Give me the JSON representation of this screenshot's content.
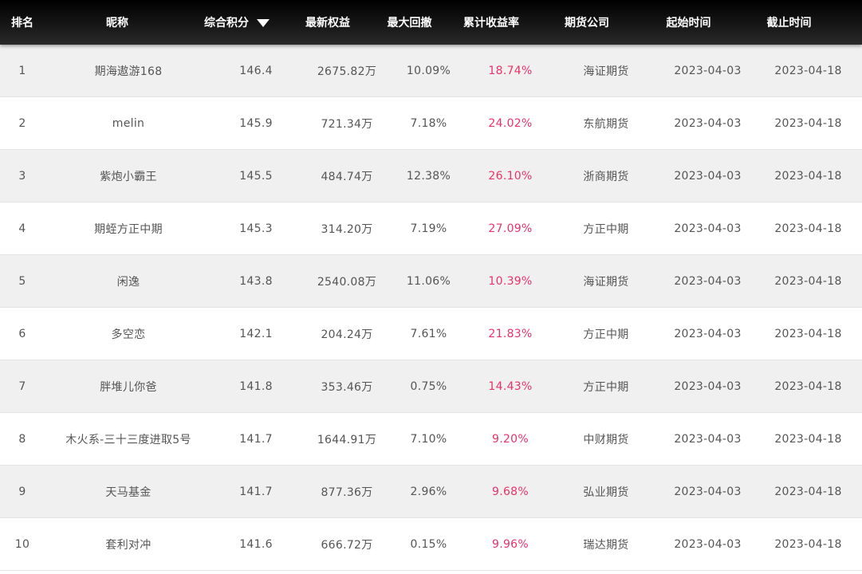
{
  "header": {
    "rank": "排名",
    "nickname": "昵称",
    "score": "综合积分",
    "equity": "最新权益",
    "drawdown": "最大回撤",
    "return": "累计收益率",
    "company": "期货公司",
    "start": "起始时间",
    "end": "截止时间",
    "sort_icon": "caret-down-icon"
  },
  "colors": {
    "header_bg": "#000000",
    "return_color": "#e8336a",
    "stripe": "#f0f0f0"
  },
  "rows": [
    {
      "rank": "1",
      "nickname": "期海遨游168",
      "score": "146.4",
      "equity": "2675.82万",
      "drawdown": "10.09%",
      "return": "18.74%",
      "company": "海证期货",
      "start": "2023-04-03",
      "end": "2023-04-18"
    },
    {
      "rank": "2",
      "nickname": "melin",
      "score": "145.9",
      "equity": "721.34万",
      "drawdown": "7.18%",
      "return": "24.02%",
      "company": "东航期货",
      "start": "2023-04-03",
      "end": "2023-04-18"
    },
    {
      "rank": "3",
      "nickname": "紫炮小霸王",
      "score": "145.5",
      "equity": "484.74万",
      "drawdown": "12.38%",
      "return": "26.10%",
      "company": "浙商期货",
      "start": "2023-04-03",
      "end": "2023-04-18"
    },
    {
      "rank": "4",
      "nickname": "期蛭方正中期",
      "score": "145.3",
      "equity": "314.20万",
      "drawdown": "7.19%",
      "return": "27.09%",
      "company": "方正中期",
      "start": "2023-04-03",
      "end": "2023-04-18"
    },
    {
      "rank": "5",
      "nickname": "闲逸",
      "score": "143.8",
      "equity": "2540.08万",
      "drawdown": "11.06%",
      "return": "10.39%",
      "company": "海证期货",
      "start": "2023-04-03",
      "end": "2023-04-18"
    },
    {
      "rank": "6",
      "nickname": "多空恋",
      "score": "142.1",
      "equity": "204.24万",
      "drawdown": "7.61%",
      "return": "21.83%",
      "company": "方正中期",
      "start": "2023-04-03",
      "end": "2023-04-18"
    },
    {
      "rank": "7",
      "nickname": "胖堆儿你爸",
      "score": "141.8",
      "equity": "353.46万",
      "drawdown": "0.75%",
      "return": "14.43%",
      "company": "方正中期",
      "start": "2023-04-03",
      "end": "2023-04-18"
    },
    {
      "rank": "8",
      "nickname": "木火系-三十三度进取5号",
      "score": "141.7",
      "equity": "1644.91万",
      "drawdown": "7.10%",
      "return": "9.20%",
      "company": "中财期货",
      "start": "2023-04-03",
      "end": "2023-04-18"
    },
    {
      "rank": "9",
      "nickname": "天马基金",
      "score": "141.7",
      "equity": "877.36万",
      "drawdown": "2.96%",
      "return": "9.68%",
      "company": "弘业期货",
      "start": "2023-04-03",
      "end": "2023-04-18"
    },
    {
      "rank": "10",
      "nickname": "套利对冲",
      "score": "141.6",
      "equity": "666.72万",
      "drawdown": "0.15%",
      "return": "9.96%",
      "company": "瑞达期货",
      "start": "2023-04-03",
      "end": "2023-04-18"
    }
  ]
}
